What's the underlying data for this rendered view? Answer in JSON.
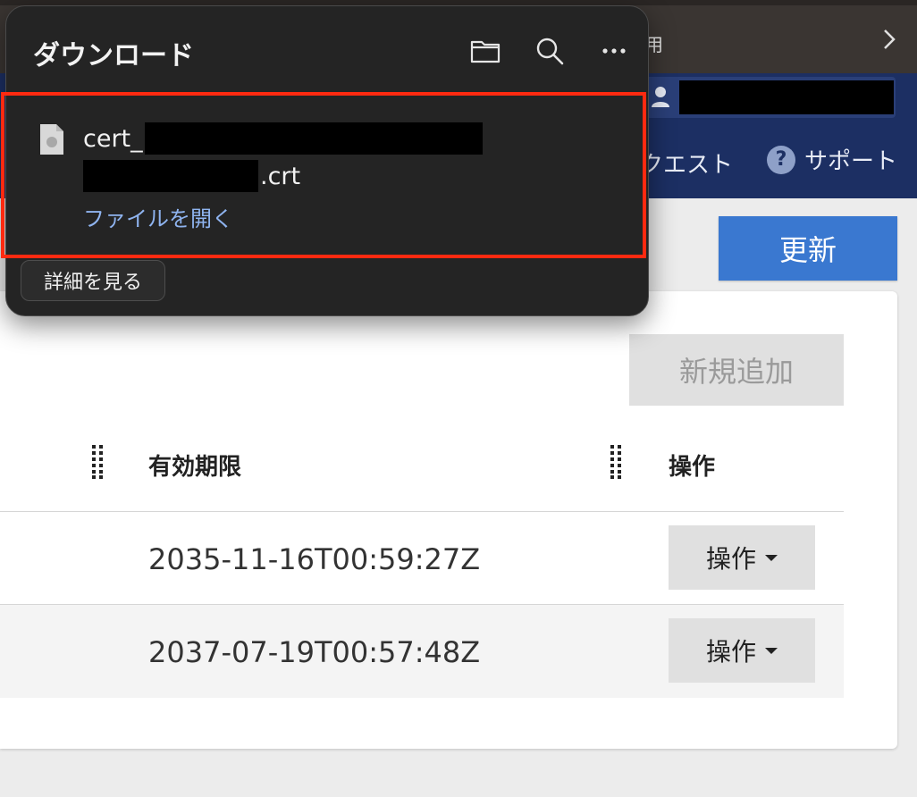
{
  "browser": {
    "toolbar_text": "用"
  },
  "header": {
    "nav_request": "クエスト",
    "support": "サポート",
    "help_glyph": "?"
  },
  "toolbar": {
    "refresh": "更新"
  },
  "card": {
    "add_new": "新規追加",
    "columns": [
      "有効期限",
      "操作"
    ],
    "rows": [
      {
        "expiry": "2035-11-16T00:59:27Z",
        "action": "操作"
      },
      {
        "expiry": "2037-07-19T00:57:48Z",
        "action": "操作"
      }
    ]
  },
  "download_popup": {
    "title": "ダウンロード",
    "item": {
      "name_prefix": "cert_",
      "name_suffix": ".crt",
      "open_link": "ファイルを開く"
    },
    "details_button": "詳細を見る"
  },
  "colors": {
    "accent_blue": "#3a78d0",
    "header_navy": "#1c2f63",
    "highlight_red": "#ff2a10",
    "link_blue": "#8fb4f0"
  }
}
